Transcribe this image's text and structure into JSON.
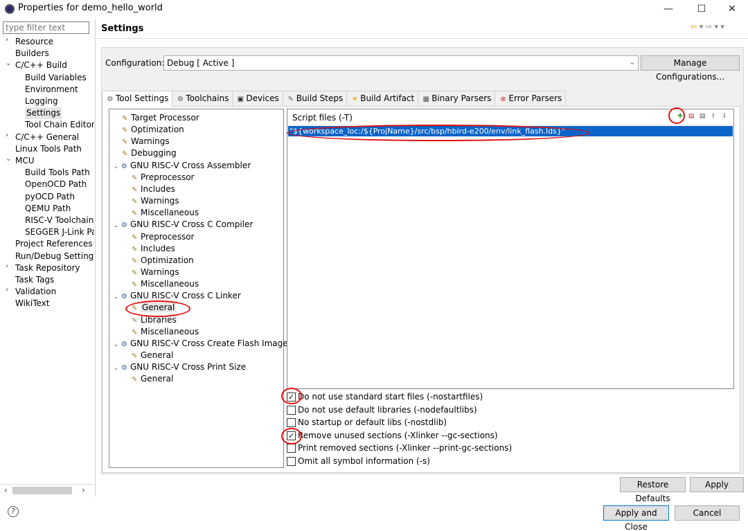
{
  "window": {
    "title": "Properties for demo_hello_world",
    "minimize": "—",
    "maximize": "☐",
    "close": "✕"
  },
  "filter": {
    "placeholder": "type filter text"
  },
  "nav": [
    {
      "label": "Resource",
      "chev": "›"
    },
    {
      "label": "Builders",
      "chev": ""
    },
    {
      "label": "C/C++ Build",
      "chev": "⌄"
    },
    {
      "label": "Build Variables",
      "chev": ""
    },
    {
      "label": "Environment",
      "chev": ""
    },
    {
      "label": "Logging",
      "chev": ""
    },
    {
      "label": "Settings",
      "chev": ""
    },
    {
      "label": "Tool Chain Editor",
      "chev": ""
    },
    {
      "label": "C/C++ General",
      "chev": "›"
    },
    {
      "label": "Linux Tools Path",
      "chev": ""
    },
    {
      "label": "MCU",
      "chev": "⌄"
    },
    {
      "label": "Build Tools Path",
      "chev": ""
    },
    {
      "label": "OpenOCD Path",
      "chev": ""
    },
    {
      "label": "pyOCD Path",
      "chev": ""
    },
    {
      "label": "QEMU Path",
      "chev": ""
    },
    {
      "label": "RISC-V Toolchain",
      "chev": ""
    },
    {
      "label": "SEGGER J-Link Pa",
      "chev": ""
    },
    {
      "label": "Project References",
      "chev": ""
    },
    {
      "label": "Run/Debug Setting:",
      "chev": ""
    },
    {
      "label": "Task Repository",
      "chev": "›"
    },
    {
      "label": "Task Tags",
      "chev": ""
    },
    {
      "label": "Validation",
      "chev": "›"
    },
    {
      "label": "WikiText",
      "chev": ""
    }
  ],
  "settings_title": "Settings",
  "configuration": {
    "label": "Configuration:",
    "value": "Debug  [ Active ]",
    "manage_button": "Manage Configurations..."
  },
  "tabs": [
    {
      "label": "Tool Settings",
      "icon": "⚙"
    },
    {
      "label": "Toolchains",
      "icon": "⚙"
    },
    {
      "label": "Devices",
      "icon": "▣"
    },
    {
      "label": "Build Steps",
      "icon": "✎"
    },
    {
      "label": "Build Artifact",
      "icon": "☀"
    },
    {
      "label": "Binary Parsers",
      "icon": "▦"
    },
    {
      "label": "Error Parsers",
      "icon": "⊗"
    }
  ],
  "tree": [
    {
      "label": "Target Processor",
      "chev": "",
      "icon": "✎"
    },
    {
      "label": "Optimization",
      "chev": "",
      "icon": "✎"
    },
    {
      "label": "Warnings",
      "chev": "",
      "icon": "✎"
    },
    {
      "label": "Debugging",
      "chev": "",
      "icon": "✎"
    },
    {
      "label": "GNU RISC-V Cross Assembler",
      "chev": "⌄",
      "icon": "⚙"
    },
    {
      "label": "Preprocessor",
      "chev": "",
      "icon": "✎"
    },
    {
      "label": "Includes",
      "chev": "",
      "icon": "✎"
    },
    {
      "label": "Warnings",
      "chev": "",
      "icon": "✎"
    },
    {
      "label": "Miscellaneous",
      "chev": "",
      "icon": "✎"
    },
    {
      "label": "GNU RISC-V Cross C Compiler",
      "chev": "⌄",
      "icon": "⚙"
    },
    {
      "label": "Preprocessor",
      "chev": "",
      "icon": "✎"
    },
    {
      "label": "Includes",
      "chev": "",
      "icon": "✎"
    },
    {
      "label": "Optimization",
      "chev": "",
      "icon": "✎"
    },
    {
      "label": "Warnings",
      "chev": "",
      "icon": "✎"
    },
    {
      "label": "Miscellaneous",
      "chev": "",
      "icon": "✎"
    },
    {
      "label": "GNU RISC-V Cross C Linker",
      "chev": "⌄",
      "icon": "⚙"
    },
    {
      "label": "General",
      "chev": "",
      "icon": "✎"
    },
    {
      "label": "Libraries",
      "chev": "",
      "icon": "✎"
    },
    {
      "label": "Miscellaneous",
      "chev": "",
      "icon": "✎"
    },
    {
      "label": "GNU RISC-V Cross Create Flash Image",
      "chev": "⌄",
      "icon": "⚙"
    },
    {
      "label": "General",
      "chev": "",
      "icon": "✎"
    },
    {
      "label": "GNU RISC-V Cross Print Size",
      "chev": "⌄",
      "icon": "⚙"
    },
    {
      "label": "General",
      "chev": "",
      "icon": "✎"
    }
  ],
  "script_files": {
    "label": "Script files (-T)",
    "items": [
      "\"${workspace_loc:/${ProjName}/src/bsp/hbird-e200/env/link_flash.lds}\""
    ]
  },
  "options": [
    {
      "label": "Do not use standard start files (-nostartfiles)",
      "checked": true,
      "mark": "✓"
    },
    {
      "label": "Do not use default libraries (-nodefaultlibs)",
      "checked": false,
      "mark": ""
    },
    {
      "label": "No startup or default libs (-nostdlib)",
      "checked": false,
      "mark": ""
    },
    {
      "label": "Remove unused sections (-Xlinker --gc-sections)",
      "checked": true,
      "mark": "✓"
    },
    {
      "label": "Print removed sections (-Xlinker --print-gc-sections)",
      "checked": false,
      "mark": ""
    },
    {
      "label": "Omit all symbol information (-s)",
      "checked": false,
      "mark": ""
    }
  ],
  "buttons": {
    "restore_defaults": "Restore Defaults",
    "apply": "Apply",
    "apply_and_close": "Apply and Close",
    "cancel": "Cancel"
  },
  "help": "?",
  "colors": {
    "selection": "#0a64c8",
    "annotation": "#e01010",
    "primary_border": "#0078d7"
  }
}
